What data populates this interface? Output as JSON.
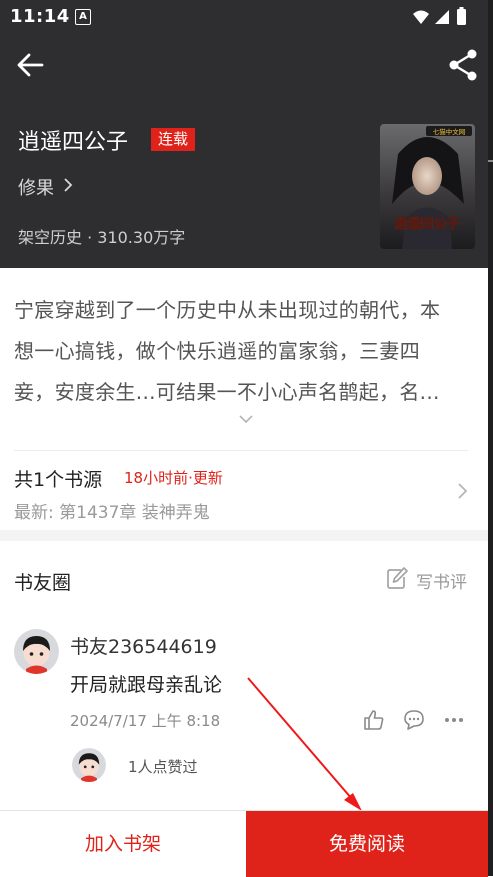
{
  "status_bar": {
    "time": "11:14",
    "indicator": "A"
  },
  "book": {
    "title": "逍遥四公子",
    "badge": "连载",
    "author": "修果",
    "meta": "架空历史 · 310.30万字",
    "cover_title": "逍遥四公子",
    "cover_publisher": "七猫中文网"
  },
  "synopsis": {
    "lines": [
      "宁宸穿越到了一个历史中从未出现过的朝代，本",
      "想一心搞钱，做个快乐逍遥的富家翁，三妻四",
      "妾，安度余生...可结果一不小心声名鹊起，名..."
    ]
  },
  "sources": {
    "title": "共1个书源",
    "updated": "18小时前·更新",
    "latest": "最新:  第1437章  装神弄鬼"
  },
  "community": {
    "title": "书友圈",
    "write_review": "写书评",
    "post": {
      "user": "书友236544619",
      "text": "开局就跟母亲乱论",
      "time": "2024/7/17 上午 8:18",
      "likes": "1人点赞过"
    }
  },
  "bottom_bar": {
    "add_shelf": "加入书架",
    "read_free": "免费阅读"
  },
  "colors": {
    "accent": "#e0231a",
    "header_bg": "#2e2e30"
  },
  "icons": [
    "back-arrow-icon",
    "share-icon",
    "chevron-right-icon",
    "chevron-down-icon",
    "edit-icon",
    "thumbs-up-icon",
    "comment-icon",
    "more-icon",
    "wifi-icon",
    "signal-icon",
    "battery-icon"
  ]
}
